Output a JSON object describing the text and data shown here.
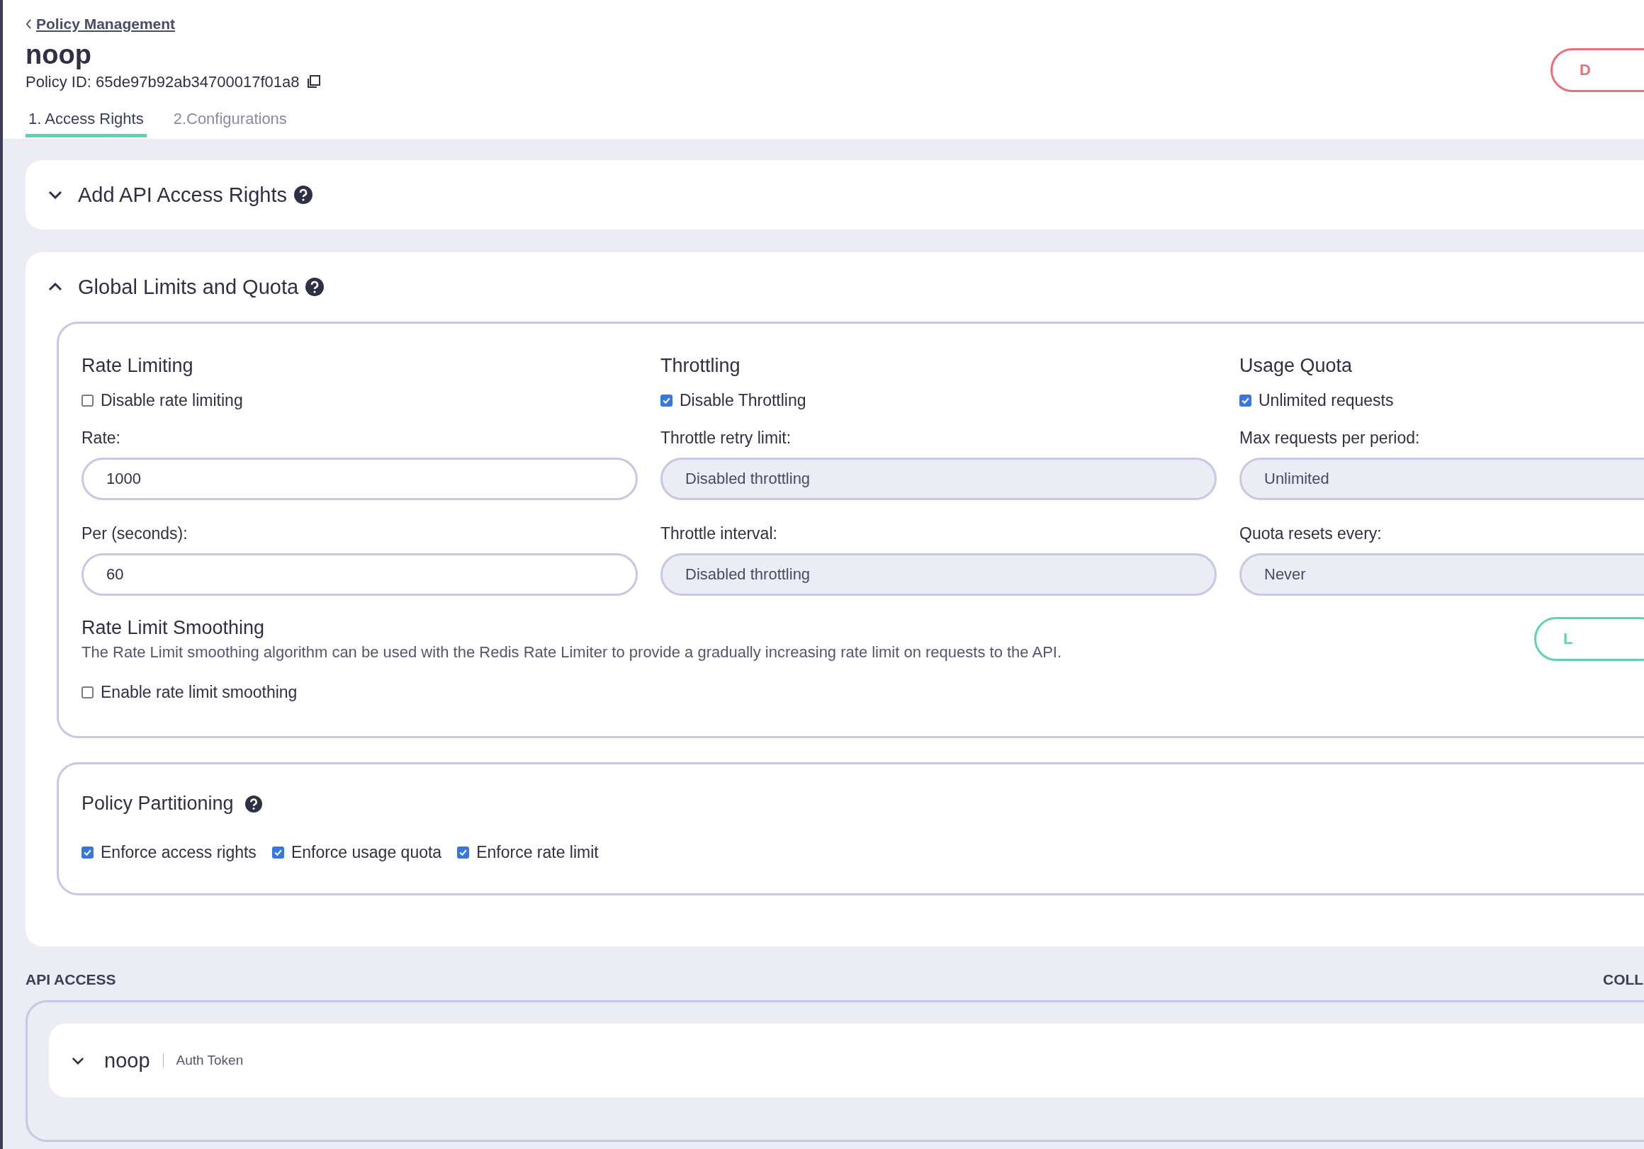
{
  "back_link": "Policy Management",
  "title": "noop",
  "policy_id": "Policy ID: 65de97b92ab34700017f01a8",
  "delete_button": "D",
  "tabs": [
    {
      "label": "1. Access Rights",
      "selected": true
    },
    {
      "label": "2.Configurations",
      "selected": false
    }
  ],
  "sections": [
    {
      "title": "Add API Access Rights",
      "expanded": false
    },
    {
      "title": "Global Limits and Quota",
      "expanded": true,
      "limits": {
        "columns": [
          {
            "heading": "Rate Limiting",
            "checkbox": {
              "label": "Disable rate limiting",
              "checked": false
            },
            "fields": [
              {
                "label": "Rate:",
                "value": "1000",
                "disabled": false
              },
              {
                "label": "Per (seconds):",
                "value": "60",
                "disabled": false
              }
            ]
          },
          {
            "heading": "Throttling",
            "checkbox": {
              "label": "Disable Throttling",
              "checked": true
            },
            "fields": [
              {
                "label": "Throttle retry limit:",
                "value": "Disabled throttling",
                "disabled": true
              },
              {
                "label": "Throttle interval:",
                "value": "Disabled throttling",
                "disabled": true
              }
            ]
          },
          {
            "heading": "Usage Quota",
            "checkbox": {
              "label": "Unlimited requests",
              "checked": true
            },
            "fields": [
              {
                "label": "Max requests per period:",
                "value": "Unlimited",
                "disabled": true
              },
              {
                "label": "Quota resets every:",
                "value": "Never",
                "disabled": true
              }
            ]
          }
        ],
        "smoothing": {
          "heading": "Rate Limit Smoothing",
          "description": "The Rate Limit smoothing algorithm can be used with the Redis Rate Limiter to provide a gradually increasing rate limit on requests to the API.",
          "checkbox": {
            "label": "Enable rate limit smoothing",
            "checked": false
          },
          "button": "L"
        }
      },
      "partitioning": {
        "title": "Policy Partitioning",
        "options": [
          {
            "label": "Enforce access rights",
            "checked": true
          },
          {
            "label": "Enforce usage quota",
            "checked": true
          },
          {
            "label": "Enforce rate limit",
            "checked": true
          }
        ]
      }
    }
  ],
  "api_access": {
    "heading": "API ACCESS",
    "collapse_link": "COLL",
    "apis": [
      {
        "name": "noop",
        "auth": "Auth Token",
        "expanded": false
      }
    ]
  }
}
